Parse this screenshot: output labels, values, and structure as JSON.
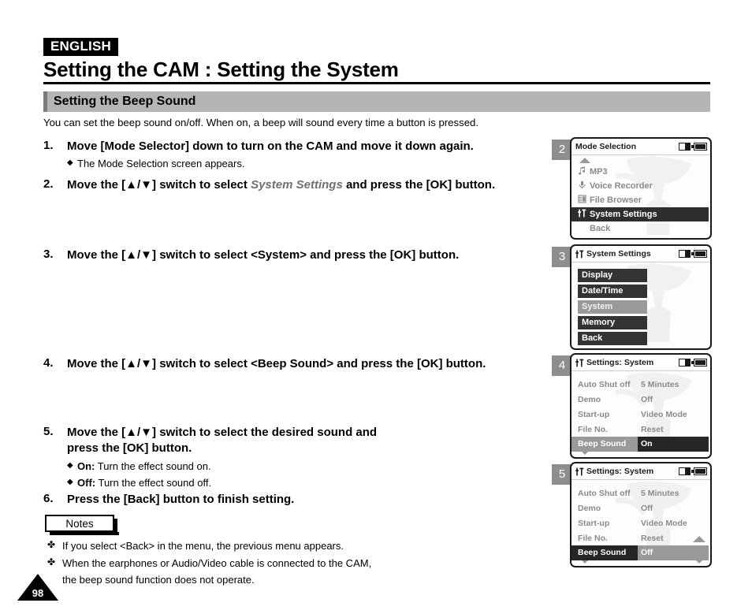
{
  "header": {
    "language_badge": "ENGLISH",
    "title": "Setting the CAM : Setting the System",
    "section_title": "Setting the Beep Sound",
    "intro": "You can set the beep sound on/off. When on, a beep will sound every time a button is pressed."
  },
  "steps": [
    {
      "num": "1.",
      "text_html": "Move [Mode Selector] down to turn on the CAM and move it down again.",
      "sub": [
        {
          "bullet": "◆",
          "text_html": "The Mode Selection screen appears."
        }
      ]
    },
    {
      "num": "2.",
      "text_html": "Move the [▲/▼] switch to select <i class=\"em-italic\">System Settings</i> and press the [OK] button.",
      "sub": []
    },
    {
      "num": "3.",
      "text_html": "Move the [▲/▼] switch to select &lt;System&gt; and press the [OK] button.",
      "sub": []
    },
    {
      "num": "4.",
      "text_html": "Move the [▲/▼] switch to select &lt;Beep Sound&gt; and press the [OK] button.",
      "sub": []
    },
    {
      "num": "5.",
      "text_html": "Move the [▲/▼] switch to select the desired sound and<br>press the [OK] button.",
      "sub": [
        {
          "bullet": "◆",
          "text_html": "<b>On:</b> Turn the effect sound on."
        },
        {
          "bullet": "◆",
          "text_html": "<b>Off:</b> Turn the effect sound off."
        }
      ]
    },
    {
      "num": "6.",
      "text_html": "Press the [Back] button to finish setting.",
      "sub": []
    }
  ],
  "notes": {
    "label": "Notes",
    "items": [
      {
        "mark": "✤",
        "text": "If you select <Back> in the menu, the previous menu appears."
      },
      {
        "mark": "✤",
        "text": "When the earphones or Audio/Video cable is connected to the CAM,",
        "continuation": "the beep sound function does not operate."
      }
    ]
  },
  "page_number": "98",
  "lcd_panels": [
    {
      "badge": "2",
      "title": "Mode Selection",
      "icons": [
        "memory-card-icon",
        "battery-icon"
      ],
      "scroll_up": true,
      "scroll_down": false,
      "style": "menu",
      "rows": [
        {
          "icon": "♪",
          "icon_name": "music-note-icon",
          "label": "MP3",
          "selected": false
        },
        {
          "icon": "♉",
          "icon_name": "microphone-icon",
          "label": "Voice Recorder",
          "selected": false
        },
        {
          "icon": "☷",
          "icon_name": "file-browser-icon",
          "label": "File Browser",
          "selected": false
        },
        {
          "icon": "↕",
          "icon_name": "sliders-icon",
          "label": "System Settings",
          "selected": true
        },
        {
          "icon": "",
          "icon_name": "",
          "label": "Back",
          "selected": false
        }
      ]
    },
    {
      "badge": "3",
      "title": "System Settings",
      "title_icon": "sliders-icon",
      "icons": [
        "memory-card-icon",
        "battery-icon"
      ],
      "style": "blocks",
      "rows": [
        {
          "label": "Display",
          "selected": false
        },
        {
          "label": "Date/Time",
          "selected": false
        },
        {
          "label": "System",
          "selected": true
        },
        {
          "label": "Memory",
          "selected": false
        },
        {
          "label": "Back",
          "selected": false
        }
      ]
    },
    {
      "badge": "4",
      "title": "Settings: System",
      "title_icon": "sliders-icon",
      "icons": [
        "memory-card-icon",
        "battery-icon"
      ],
      "style": "settings",
      "scroll_down": true,
      "scroll_up": false,
      "rows": [
        {
          "key": "Auto Shut off",
          "value": "5 Minutes",
          "state": "normal"
        },
        {
          "key": "Demo",
          "value": "Off",
          "state": "normal"
        },
        {
          "key": "Start-up",
          "value": "Video Mode",
          "state": "normal"
        },
        {
          "key": "File No.",
          "value": "Reset",
          "state": "normal"
        },
        {
          "key": "Beep Sound",
          "value": "On",
          "state": "focused-key-gray-value-dark"
        }
      ]
    },
    {
      "badge": "5",
      "title": "Settings: System",
      "title_icon": "sliders-icon",
      "icons": [
        "memory-card-icon",
        "battery-icon"
      ],
      "style": "settings",
      "scroll_down": true,
      "scroll_up": true,
      "value_updown": true,
      "rows": [
        {
          "key": "Auto Shut off",
          "value": "5 Minutes",
          "state": "normal"
        },
        {
          "key": "Demo",
          "value": "Off",
          "state": "normal"
        },
        {
          "key": "Start-up",
          "value": "Video Mode",
          "state": "normal"
        },
        {
          "key": "File No.",
          "value": "Reset",
          "state": "normal"
        },
        {
          "key": "Beep Sound",
          "value": "Off",
          "state": "editing-key-dark-value-gray"
        }
      ]
    }
  ],
  "colors": {
    "section_bar": "#b5b5b5",
    "badge": "#8e8e8e",
    "lcd_selected_dark": "#2e2e2e",
    "lcd_selected_gray": "#9a9a9a",
    "lcd_text_gray": "#8a8a8a"
  }
}
